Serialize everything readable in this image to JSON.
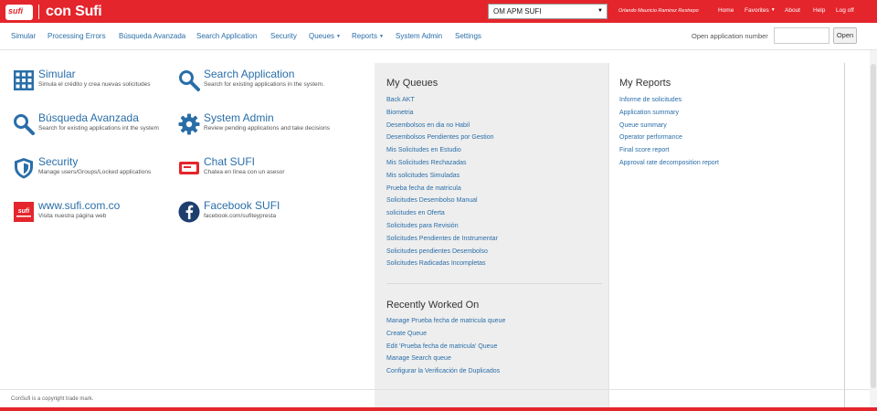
{
  "brand": {
    "badge": "sufi",
    "name": "con Sufi",
    "color": "#e4252c"
  },
  "top_select": {
    "value": "OM APM SUFI"
  },
  "top_links": {
    "user": "Orlando Mauricio Ramirez Restrepo",
    "home": "Home",
    "favorites": "Favorites",
    "about": "About",
    "help": "Help",
    "logoff": "Log off"
  },
  "nav": {
    "items": [
      {
        "label": "Simular"
      },
      {
        "label": "Processing Errors"
      },
      {
        "label": "Búsqueda Avanzada"
      },
      {
        "label": "Search Application"
      },
      {
        "label": "Security"
      },
      {
        "label": "Queues"
      },
      {
        "label": "Reports"
      },
      {
        "label": "System Admin"
      },
      {
        "label": "Settings"
      }
    ],
    "open_app_label": "Open application number",
    "open_button": "Open",
    "open_value": ""
  },
  "tiles": [
    {
      "title": "Simular",
      "desc": "Simula el crédito y crea nuevas solicitudes",
      "icon": "calculator-icon"
    },
    {
      "title": "Search Application",
      "desc": "Search for existing applications in the system.",
      "icon": "search-icon"
    },
    {
      "title": "Búsqueda Avanzada",
      "desc": "Search for existing applications int the system",
      "icon": "search-icon"
    },
    {
      "title": "System Admin",
      "desc": "Review pending applications and take decisions",
      "icon": "gear-icon"
    },
    {
      "title": "Security",
      "desc": "Manage users/Groups/Locked applications",
      "icon": "shield-icon"
    },
    {
      "title": "Chat SUFI",
      "desc": "Chatea en línea con un asesor",
      "icon": "chat-icon"
    },
    {
      "title": "www.sufi.com.co",
      "desc": "Visita nuestra página web",
      "icon": "sufi-logo-icon"
    },
    {
      "title": "Facebook SUFI",
      "desc": "facebook.com/sufiteypresta",
      "icon": "facebook-icon"
    }
  ],
  "my_queues": {
    "title": "My Queues",
    "items": [
      "Back AKT",
      "Biometria",
      "Desembolsos en dia no Habil",
      "Desembolsos Pendientes por Gestion",
      "Mis Solicitudes en Estudio",
      "Mis Solicitudes Rechazadas",
      "Mis solicitudes Simuladas",
      "Prueba fecha de matricula",
      "Solicitudes Desembolso Manual",
      "solicitudes en Oferta",
      "Solicitudes para Revisión",
      "Solicitudes Pendientes de Instrumentar",
      "Solicitudes pendientes Desembolso",
      "Solicitudes Radicadas Incompletas"
    ]
  },
  "recently_worked": {
    "title": "Recently Worked On",
    "items": [
      "Manage Prueba fecha de matricula queue",
      "Create Queue",
      "Edit 'Prueba fecha de matricula' Queue",
      "Manage Search queue",
      "Configurar la Verificación de Duplicados"
    ]
  },
  "my_reports": {
    "title": "My Reports",
    "items": [
      "Informe de solicitudes",
      "Application summary",
      "Queue summary",
      "Operator performance",
      "Final score report",
      "Approval rate decomposition report"
    ]
  },
  "footer": "ConSufi is a copyright trade mark."
}
